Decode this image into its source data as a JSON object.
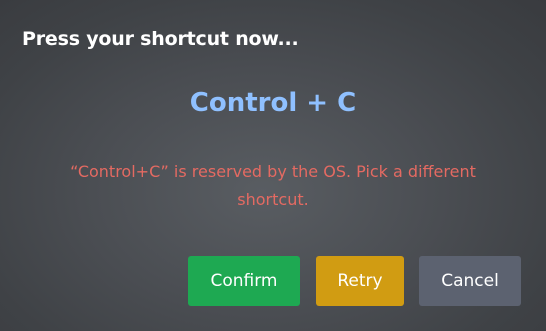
{
  "dialog": {
    "title": "Press your shortcut now...",
    "shortcut": "Control + C",
    "error": "“Control+C” is reserved by the OS. Pick a different shortcut."
  },
  "buttons": {
    "confirm": "Confirm",
    "retry": "Retry",
    "cancel": "Cancel"
  },
  "colors": {
    "shortcut_text": "#8fc0ff",
    "error_text": "#e46a62",
    "confirm": "#1ea952",
    "retry": "#d19c12",
    "cancel": "#5c6270"
  }
}
